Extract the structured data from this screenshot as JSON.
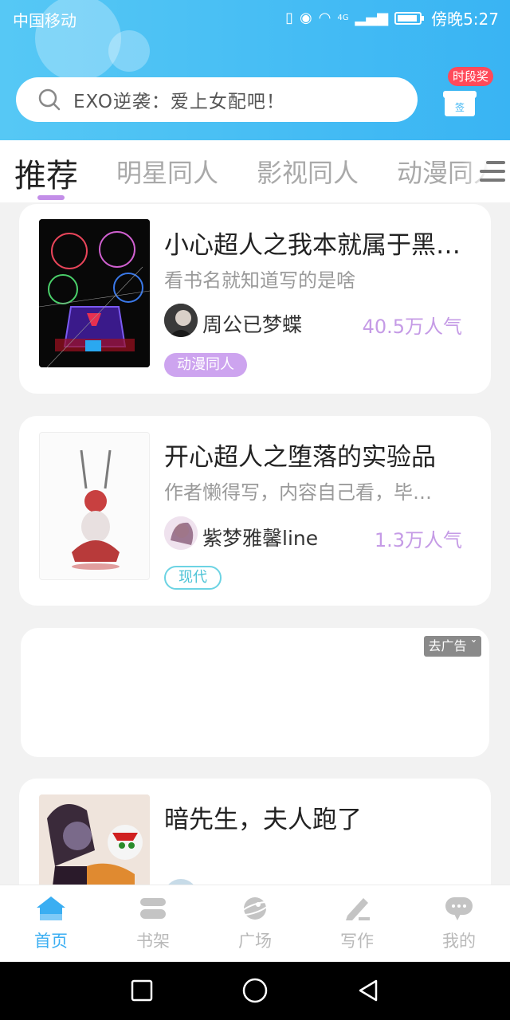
{
  "status_bar": {
    "carrier": "中国移动",
    "time": "傍晚5:27",
    "network": "4G"
  },
  "search": {
    "placeholder": "EXO逆袭：爱上女配吧！"
  },
  "sign_in": {
    "badge": "时段奖",
    "icon_text": "签"
  },
  "tabs": [
    {
      "label": "推荐",
      "active": true
    },
    {
      "label": "明星同人",
      "active": false
    },
    {
      "label": "影视同人",
      "active": false
    },
    {
      "label": "动漫同人",
      "active": false
    }
  ],
  "books": [
    {
      "title": "小心超人之我本就属于黑…",
      "description": "看书名就知道写的是啥",
      "author": "周公已梦蝶",
      "popularity": "40.5万人气",
      "tag": "动漫同人"
    },
    {
      "title": "开心超人之堕落的实验品",
      "description": "作者懒得写，内容自己看，毕…",
      "author": "紫梦雅馨line",
      "popularity": "1.3万人气",
      "tag": "现代"
    },
    {
      "title": "暗先生，夫人跑了"
    }
  ],
  "ad": {
    "remove_label": "去广告 ˇ"
  },
  "bottom_nav": [
    {
      "label": "首页",
      "active": true
    },
    {
      "label": "书架",
      "active": false
    },
    {
      "label": "广场",
      "active": false
    },
    {
      "label": "写作",
      "active": false
    },
    {
      "label": "我的",
      "active": false
    }
  ],
  "colors": {
    "header": "#39b4f3",
    "accent": "#c59be6",
    "nav_active": "#3aaef2"
  }
}
